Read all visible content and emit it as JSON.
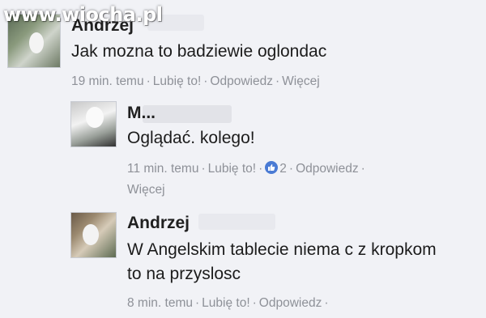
{
  "watermark": "www.wiocha.pl",
  "colors": {
    "background": "#f1f2f6",
    "meta_text": "#8e9198",
    "like_badge": "#4a7bd4"
  },
  "comments": [
    {
      "author": "Andrzej",
      "text_lines": [
        "Jak mozna to badziewie oglondac"
      ],
      "meta": {
        "time": "19 min. temu",
        "like": "Lubię to!",
        "reply": "Odpowiedz",
        "more": "Więcej"
      }
    },
    {
      "author": "M...",
      "text_lines": [
        "Oglądać. kolego!"
      ],
      "meta": {
        "time": "11 min. temu",
        "like": "Lubię to!",
        "like_count": "2",
        "reply": "Odpowiedz",
        "more": "Więcej",
        "like_icon": "thumbs-up-icon"
      }
    },
    {
      "author": "Andrzej",
      "text_lines": [
        "W Angelskim tablecie niema c z kropkom",
        "to na przyslosc"
      ],
      "meta": {
        "time": "8 min. temu",
        "like": "Lubię to!",
        "reply": "Odpowiedz"
      }
    }
  ]
}
